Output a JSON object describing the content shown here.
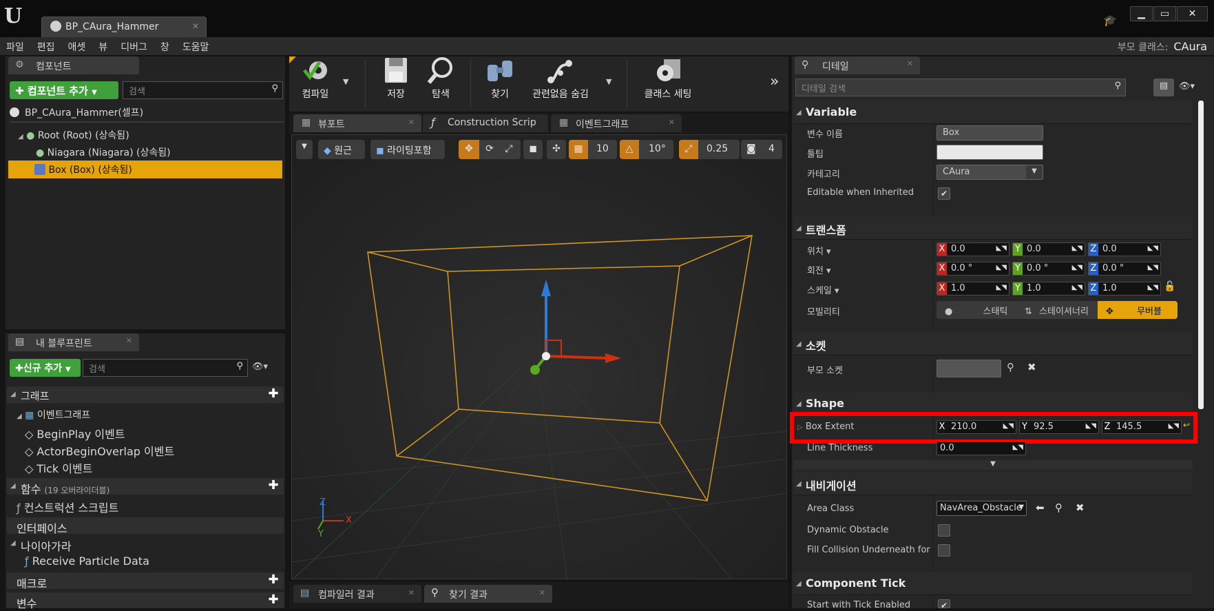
{
  "window": {
    "tab_title": "BP_CAura_Hammer",
    "parent_class_label": "부모 클래스:",
    "parent_class_value": "CAura"
  },
  "menu": [
    "파일",
    "편집",
    "애셋",
    "뷰",
    "디버그",
    "창",
    "도움말"
  ],
  "components": {
    "tab": "컴포넌트",
    "add_button": "컴포넌트 추가",
    "search_placeholder": "검색",
    "self_item": "BP_CAura_Hammer(셀프)",
    "tree": [
      {
        "label": "Root (Root) (상속됨)"
      },
      {
        "label": "Niagara (Niagara) (상속됨)"
      },
      {
        "label": "Box (Box) (상속됨)"
      }
    ]
  },
  "my_blueprint": {
    "tab": "내 블루프린트",
    "add_button": "신규 추가",
    "search_placeholder": "검색",
    "graph_section": "그래프",
    "event_graph": "이벤트그래프",
    "events": [
      "BeginPlay 이벤트",
      "ActorBeginOverlap 이벤트",
      "Tick 이벤트"
    ],
    "functions_section": "함수",
    "functions_note": "(19 오버라이더블)",
    "construction_script": "컨스트럭션 스크립트",
    "interfaces_section": "인터페이스",
    "niagara_section": "나이아가라",
    "niagara_item": "Receive Particle Data",
    "macros_section": "매크로",
    "variables_section": "변수"
  },
  "toolbar": {
    "compile": "컴파일",
    "save": "저장",
    "browse": "탐색",
    "find": "찾기",
    "hide_unrelated": "관련없음 숨김",
    "class_settings": "클래스 세팅"
  },
  "editor_tabs": [
    "뷰포트",
    "Construction Scrip",
    "이벤트그래프"
  ],
  "viewport": {
    "perspective": "원근",
    "lit": "라이팅포함",
    "grid_snap": "10",
    "rot_snap": "10°",
    "scale_snap": "0.25",
    "cam_speed": "4",
    "axis_x": "X",
    "axis_y": "Y",
    "axis_z": "Z"
  },
  "bottom_tabs": [
    "컴파일러 결과",
    "찾기 결과"
  ],
  "details": {
    "tab": "디테일",
    "search_placeholder": "디테일 검색",
    "variable": {
      "header": "Variable",
      "name_label": "변수 이름",
      "name_value": "Box",
      "tooltip_label": "툴팁",
      "tooltip_value": "",
      "category_label": "카테고리",
      "category_value": "CAura",
      "editable_label": "Editable when Inherited"
    },
    "transform": {
      "header": "트랜스폼",
      "location_label": "위치",
      "rotation_label": "회전",
      "scale_label": "스케일",
      "mobility_label": "모빌리티",
      "location": [
        "0.0",
        "0.0",
        "0.0"
      ],
      "rotation": [
        "0.0 °",
        "0.0 °",
        "0.0 °"
      ],
      "scale": [
        "1.0",
        "1.0",
        "1.0"
      ],
      "mobility_options": [
        "스태틱",
        "스테이셔너리",
        "무버블"
      ]
    },
    "sockets": {
      "header": "소켓",
      "parent_socket_label": "부모 소켓"
    },
    "shape": {
      "header": "Shape",
      "box_extent_label": "Box Extent",
      "box_extent": [
        "210.0",
        "92.5",
        "145.5"
      ],
      "line_thickness_label": "Line Thickness",
      "line_thickness": "0.0"
    },
    "navigation": {
      "header": "내비게이션",
      "area_class_label": "Area Class",
      "area_class_value": "NavArea_Obstacle",
      "dynamic_obstacle_label": "Dynamic Obstacle",
      "fill_collision_label": "Fill Collision Underneath for Nav"
    },
    "component_tick": {
      "header": "Component Tick",
      "start_tick_label": "Start with Tick Enabled"
    }
  },
  "colors": {
    "selection": "#e5a50a",
    "highlight_box": "#ff0000",
    "wireframe": "#d89a1a"
  }
}
